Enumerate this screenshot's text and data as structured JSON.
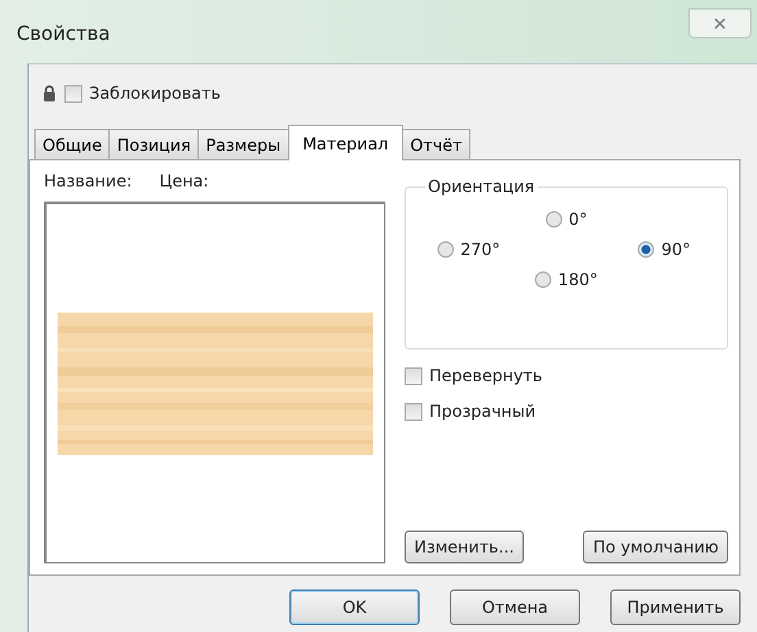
{
  "window": {
    "title": "Свойства",
    "close": "✕"
  },
  "lock": {
    "label": "Заблокировать",
    "checked": false
  },
  "tabs": [
    {
      "label": "Общие",
      "selected": false
    },
    {
      "label": "Позиция",
      "selected": false
    },
    {
      "label": "Размеры",
      "selected": false
    },
    {
      "label": "Материал",
      "selected": true
    },
    {
      "label": "Отчёт",
      "selected": false
    }
  ],
  "material": {
    "name_label": "Название:",
    "price_label": "Цена:"
  },
  "orientation": {
    "title": "Ориентация",
    "options": [
      {
        "label": "0°",
        "selected": false
      },
      {
        "label": "270°",
        "selected": false
      },
      {
        "label": "90°",
        "selected": true
      },
      {
        "label": "180°",
        "selected": false
      }
    ]
  },
  "options": [
    {
      "label": "Перевернуть",
      "checked": false
    },
    {
      "label": "Прозрачный",
      "checked": false
    }
  ],
  "material_buttons": [
    "Изменить...",
    "По умолчанию"
  ],
  "buttons": [
    {
      "label": "OK",
      "default": true
    },
    {
      "label": "Отмена",
      "default": false
    },
    {
      "label": "Применить",
      "default": false
    }
  ]
}
